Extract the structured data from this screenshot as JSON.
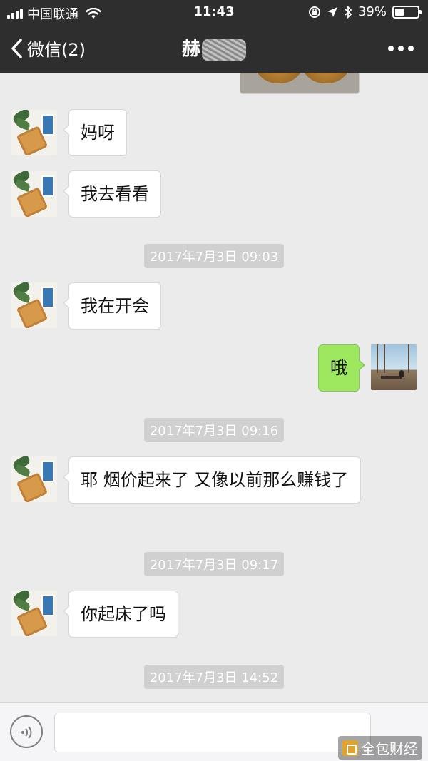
{
  "status_bar": {
    "carrier": "中国联通",
    "time": "11:43",
    "battery": "39%",
    "battery_level": 0.39
  },
  "nav": {
    "back_label": "微信(2)",
    "title": "赫"
  },
  "messages": [
    {
      "from": "other",
      "text": "妈呀"
    },
    {
      "from": "other",
      "text": "我去看看"
    },
    {
      "timestamp": "2017年7月3日 09:03"
    },
    {
      "from": "other",
      "text": "我在开会"
    },
    {
      "from": "me",
      "text": "哦"
    },
    {
      "timestamp": "2017年7月3日 09:16"
    },
    {
      "from": "other",
      "text": "耶 烟价起来了 又像以前那么赚钱了"
    },
    {
      "timestamp": "2017年7月3日 09:17"
    },
    {
      "from": "other",
      "text": "你起床了吗"
    },
    {
      "timestamp": "2017年7月3日 14:52"
    }
  ],
  "input": {
    "placeholder": ""
  },
  "watermark": "全包财经",
  "icons": {
    "back": "chevron-left-icon",
    "more": "more-icon",
    "voice": "voice-icon",
    "wifi": "wifi-icon",
    "signal": "signal-icon",
    "battery": "battery-icon"
  }
}
